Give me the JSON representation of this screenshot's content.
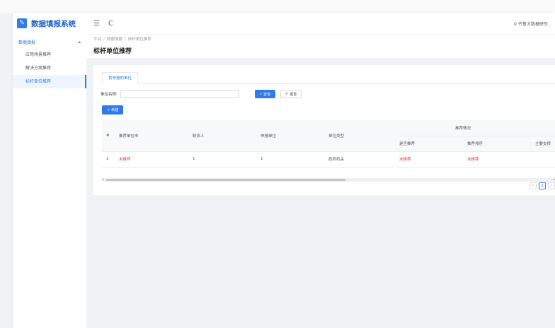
{
  "app": {
    "title": "数据填报系统",
    "logo_icon": "clipboard-edit-icon",
    "accent": "#2f7be8"
  },
  "sidebar": {
    "group_label": "数据填报",
    "items": [
      {
        "label": "应用场景推荐"
      },
      {
        "label": "解决方案推荐"
      },
      {
        "label": "标杆单位推荐"
      }
    ]
  },
  "header": {
    "menu_icon": "☰",
    "refresh_icon": "C",
    "user_label": "齐鲁大数据研究"
  },
  "breadcrumb": {
    "items": [
      "平台",
      "数据填报",
      "标杆单位推荐"
    ],
    "separator": "/"
  },
  "page": {
    "title": "标杆单位推荐"
  },
  "tabs": [
    {
      "label": "我申报的单位"
    }
  ],
  "filter": {
    "label": "单位名称:",
    "value": "",
    "placeholder": ""
  },
  "buttons": {
    "search": "查询",
    "reset": "重置",
    "add": "新建"
  },
  "table": {
    "headers": {
      "index": "#",
      "city": "推荐单位市",
      "contact": "联系人",
      "applicant": "申报单位",
      "unit_type": "单位类型",
      "group": "推荐情况",
      "is_recommended": "是否推荐",
      "order": "推荐排序",
      "support": "主要支撑"
    },
    "rows": [
      {
        "index": "1",
        "city": "未推荐",
        "contact": "1",
        "applicant": "1",
        "unit_type": "政府机关",
        "is_recommended": "未推荐",
        "order": "未推荐",
        "support": ""
      }
    ]
  },
  "pagination": {
    "prev": "<",
    "current": "1",
    "next": ">"
  },
  "colors": {
    "status_red": "#e23c3c",
    "brand_blue": "#2f7be8"
  }
}
